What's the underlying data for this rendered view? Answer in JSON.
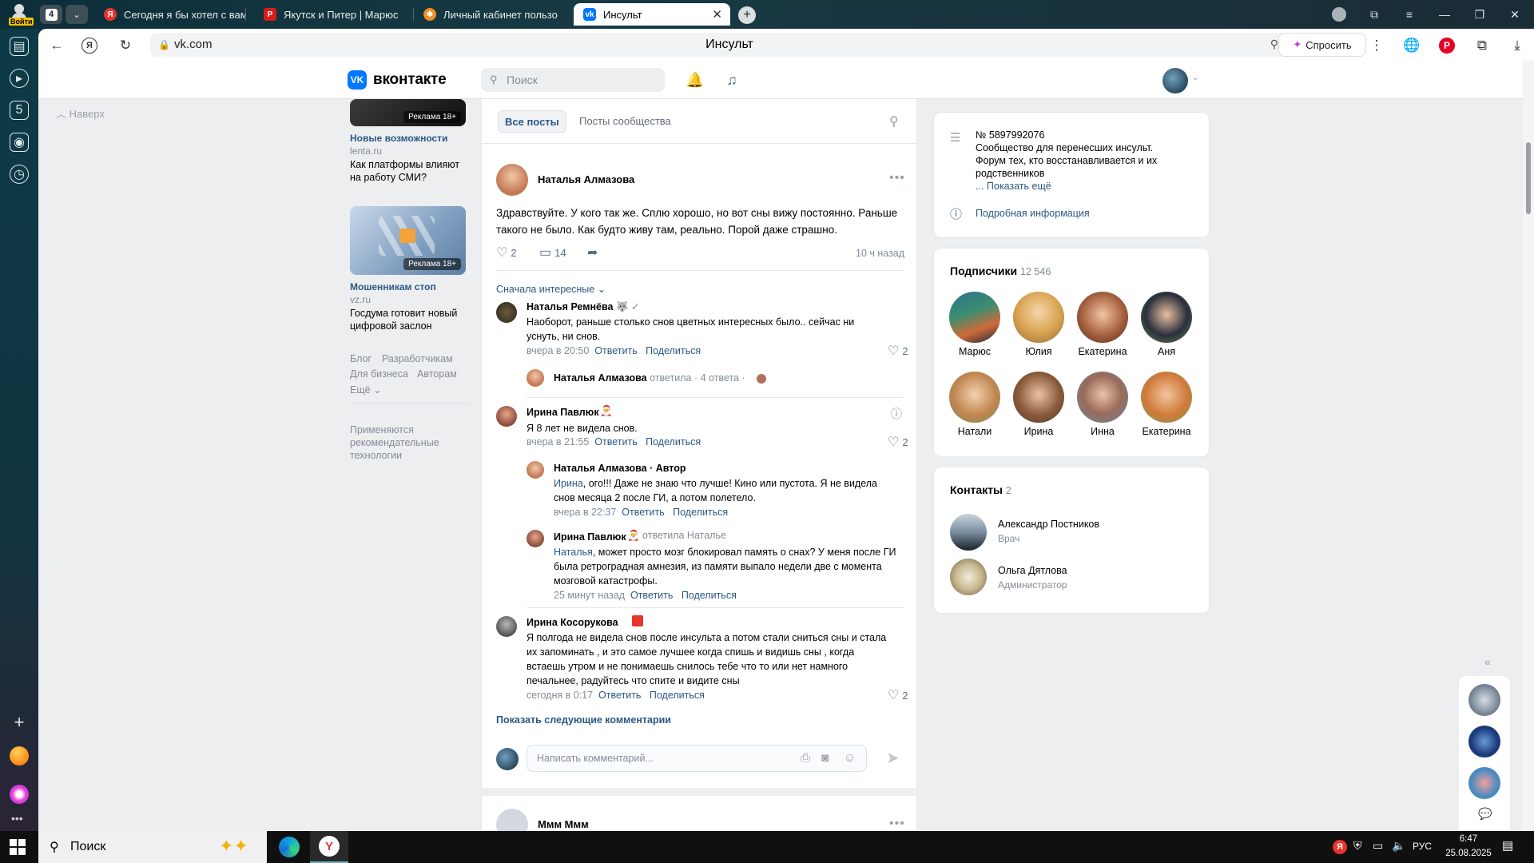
{
  "browser": {
    "profile_label": "Войти",
    "tab_count": "4",
    "tabs": [
      {
        "title": "Сегодня я бы хотел с вам",
        "favicon": "yandex",
        "color": "#e8342c"
      },
      {
        "title": "Якутск и Питер | Марюс",
        "favicon": "pinterest",
        "color": "#d91b1b"
      },
      {
        "title": "Личный кабинет пользо",
        "favicon": "orange-gear",
        "color": "#f58a1f"
      },
      {
        "title": "Инсульт",
        "favicon": "vk",
        "color": "#0077ff"
      }
    ],
    "url": "vk.com",
    "page_title": "Инсульт",
    "ask_label": "Спросить"
  },
  "vk": {
    "logo": "вконтакте",
    "search_placeholder": "Поиск"
  },
  "left": {
    "to_top": "Наверх",
    "ads": [
      {
        "badge": "Реклама 18+",
        "title": "Новые возможности",
        "domain": "lenta.ru",
        "text": "Как платформы влияют на работу СМИ?"
      },
      {
        "badge": "Реклама 18+",
        "title": "Мошенникам стоп",
        "domain": "vz.ru",
        "text": "Госдума готовит новый цифровой заслон"
      }
    ],
    "footer": {
      "blog": "Блог",
      "devs": "Разработчикам",
      "business": "Для бизнеса",
      "authors": "Авторам",
      "more": "Ещё"
    },
    "recommend": "Применяются рекомендательные технологии"
  },
  "feed": {
    "tab_all": "Все посты",
    "tab_community": "Посты сообщества",
    "post": {
      "author": "Наталья Алмазова",
      "text": "Здравствуйте. У кого так же. Сплю хорошо, но вот сны вижу постоянно. Раньше такого не было. Как будто живу там, реально. Порой даже страшно.",
      "likes": "2",
      "comments": "14",
      "time": "10 ч назад"
    },
    "sort_label": "Сначала интересные",
    "comments": [
      {
        "author": "Наталья Ремнёва",
        "text": "Наоборот, раньше столько снов цветных интересных было.. сейчас ни уснуть, ни снов.",
        "time": "вчера в 20:50",
        "reply": "Ответить",
        "share": "Поделиться",
        "likes": "2"
      },
      {
        "author": "Ирина Павлюк",
        "text": "Я 8 лет не видела снов.",
        "time": "вчера в 21:55",
        "reply": "Ответить",
        "share": "Поделиться",
        "likes": "2"
      },
      {
        "author": "Ирина Косорукова",
        "text": "Я полгода не видела снов после инсульта а потом стали сниться сны и стала их запоминать , и это самое лучшее когда спишь и видишь сны , когда встаешь утром и не понимаешь снилось тебе что то или нет намного печальнее, радуйтесь что спите и видите сны",
        "time": "сегодня в 0:17",
        "reply": "Ответить",
        "share": "Поделиться",
        "likes": "2"
      }
    ],
    "thread_collapsed": {
      "author": "Наталья Алмазова",
      "action": "ответила",
      "count": "4 ответа"
    },
    "replies": [
      {
        "author": "Наталья Алмазова · Автор",
        "mention": "Ирина",
        "text": ", ого!!! Даже не знаю что лучше! Кино или пустота. Я не видела снов месяца 2 после ГИ, а потом полетело.",
        "time": "вчера в 22:37",
        "reply": "Ответить",
        "share": "Поделиться"
      },
      {
        "author": "Ирина Павлюк",
        "action": "ответила Наталье",
        "mention": "Наталья",
        "text": ", может просто мозг блокировал память о снах? У меня после ГИ была ретроградная амнезия, из памяти выпало недели две с момента мозговой катастрофы.",
        "time": "25 минут назад",
        "reply": "Ответить",
        "share": "Поделиться"
      }
    ],
    "show_more": "Показать следующие комментарии",
    "comment_placeholder": "Написать комментарий...",
    "next_post_author": "Ммм Ммм"
  },
  "right": {
    "info": {
      "id": "№ 5897992076",
      "desc": "Сообщество для перенесших инсульт. Форум тех, кто восстанавливается и их родственников",
      "show_more": "... Показать ещё",
      "details": "Подробная информация"
    },
    "followers": {
      "title": "Подписчики",
      "count": "12 546",
      "people": [
        "Марюс",
        "Юлия",
        "Екатерина",
        "Аня",
        "Натали",
        "Ирина",
        "Инна",
        "Екатерина"
      ]
    },
    "contacts": {
      "title": "Контакты",
      "count": "2",
      "people": [
        {
          "name": "Александр Постников",
          "role": "Врач"
        },
        {
          "name": "Ольга Дятлова",
          "role": "Администратор"
        }
      ]
    }
  },
  "taskbar": {
    "search": "Поиск",
    "lang": "РУС",
    "time": "6:47",
    "date": "25.08.2025"
  }
}
